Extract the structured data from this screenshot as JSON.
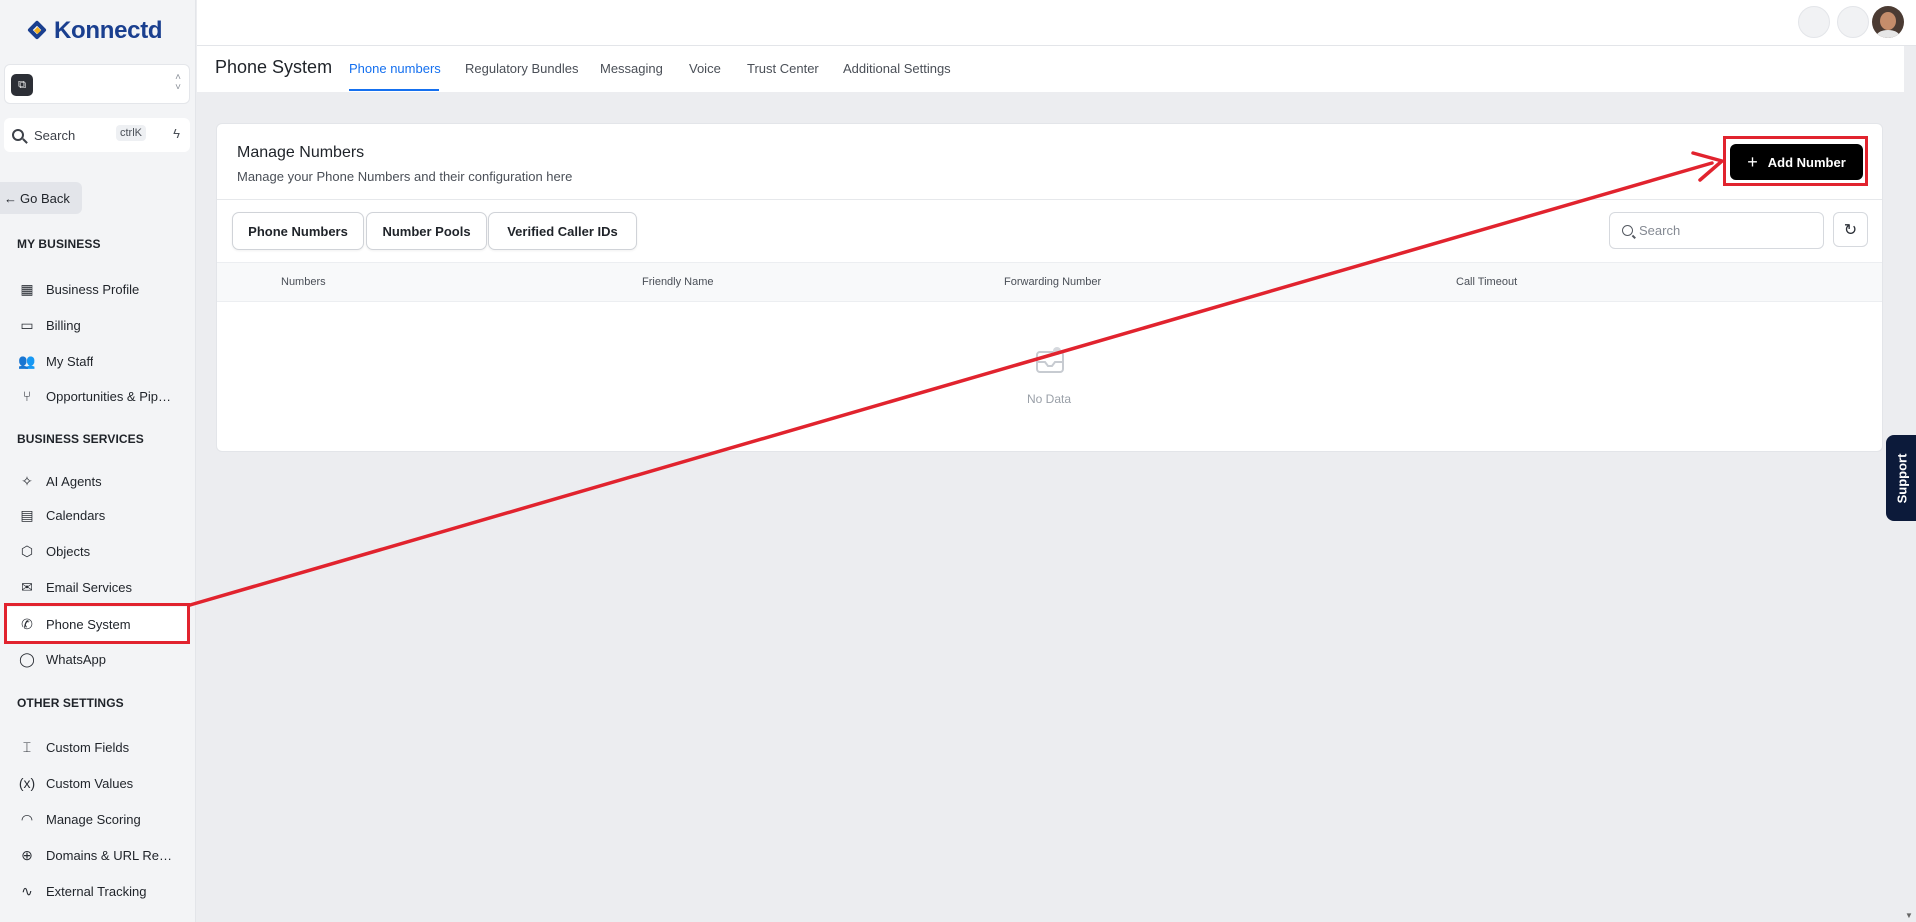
{
  "brand": {
    "name": "Konnectd"
  },
  "sidebar": {
    "search_label": "Search",
    "search_shortcut": "ctrlK",
    "go_back": "Go Back",
    "sections": [
      {
        "title": "MY BUSINESS",
        "items": [
          {
            "label": "Business Profile",
            "icon": "building-icon"
          },
          {
            "label": "Billing",
            "icon": "credit-card-icon"
          },
          {
            "label": "My Staff",
            "icon": "users-icon"
          },
          {
            "label": "Opportunities & Pipel...",
            "icon": "git-branch-icon"
          }
        ]
      },
      {
        "title": "BUSINESS SERVICES",
        "items": [
          {
            "label": "AI Agents",
            "icon": "sparkles-icon"
          },
          {
            "label": "Calendars",
            "icon": "calendar-icon"
          },
          {
            "label": "Objects",
            "icon": "cube-icon"
          },
          {
            "label": "Email Services",
            "icon": "mail-icon"
          },
          {
            "label": "Phone System",
            "icon": "phone-icon"
          },
          {
            "label": "WhatsApp",
            "icon": "chat-bubble-icon"
          }
        ]
      },
      {
        "title": "OTHER SETTINGS",
        "items": [
          {
            "label": "Custom Fields",
            "icon": "field-icon"
          },
          {
            "label": "Custom Values",
            "icon": "variable-icon"
          },
          {
            "label": "Manage Scoring",
            "icon": "gauge-icon"
          },
          {
            "label": "Domains & URL Redir...",
            "icon": "globe-icon"
          },
          {
            "label": "External Tracking",
            "icon": "activity-icon"
          }
        ]
      }
    ]
  },
  "header": {
    "title": "Phone System",
    "tabs": [
      "Phone numbers",
      "Regulatory Bundles",
      "Messaging",
      "Voice",
      "Trust Center",
      "Additional Settings"
    ],
    "active_tab": "Phone numbers"
  },
  "manage": {
    "title": "Manage Numbers",
    "subtitle": "Manage your Phone Numbers and their configuration here",
    "add_button": "Add Number",
    "segments": [
      "Phone Numbers",
      "Number Pools",
      "Verified Caller IDs"
    ],
    "search_placeholder": "Search",
    "columns": [
      "Numbers",
      "Friendly Name",
      "Forwarding Number",
      "Call Timeout"
    ],
    "empty_text": "No Data"
  },
  "support_label": "Support",
  "colors": {
    "accent": "#1570ef",
    "highlight": "#e1232e",
    "brand": "#1a3f8f"
  }
}
